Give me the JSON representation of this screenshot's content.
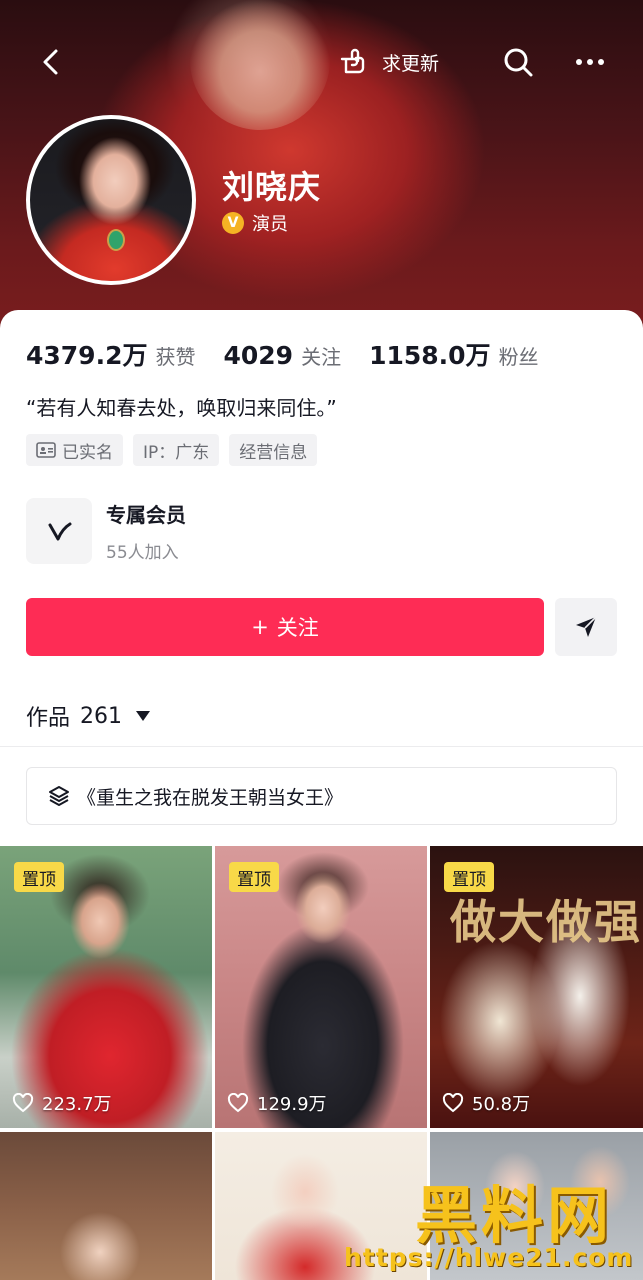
{
  "header": {
    "update_label": "求更新"
  },
  "profile": {
    "name": "刘晓庆",
    "verify_badge": "V",
    "verify_text": "演员",
    "stats": [
      {
        "value": "4379.2万",
        "label": "获赞"
      },
      {
        "value": "4029",
        "label": "关注"
      },
      {
        "value": "1158.0万",
        "label": "粉丝"
      }
    ],
    "bio": "“若有人知春去处，唤取归来同住。”",
    "tags": [
      "已实名",
      "IP：广东",
      "经营信息"
    ]
  },
  "member": {
    "title": "专属会员",
    "subtitle": "55人加入"
  },
  "actions": {
    "follow_label": "关注",
    "follow_prefix": "+"
  },
  "works": {
    "label": "作品",
    "count": "261"
  },
  "collection": {
    "title": "《重生之我在脱发王朝当女王》"
  },
  "videos": [
    {
      "pinned": "置顶",
      "likes": "223.7万"
    },
    {
      "pinned": "置顶",
      "likes": "129.9万"
    },
    {
      "pinned": "置顶",
      "likes": "50.8万",
      "cover_text": "做大做强"
    }
  ],
  "watermark": {
    "title": "黑料网",
    "url": "https://hlwe21.com"
  },
  "colors": {
    "accent": "#fe2c55",
    "pin": "#f8d948",
    "verify": "#f5b324"
  }
}
